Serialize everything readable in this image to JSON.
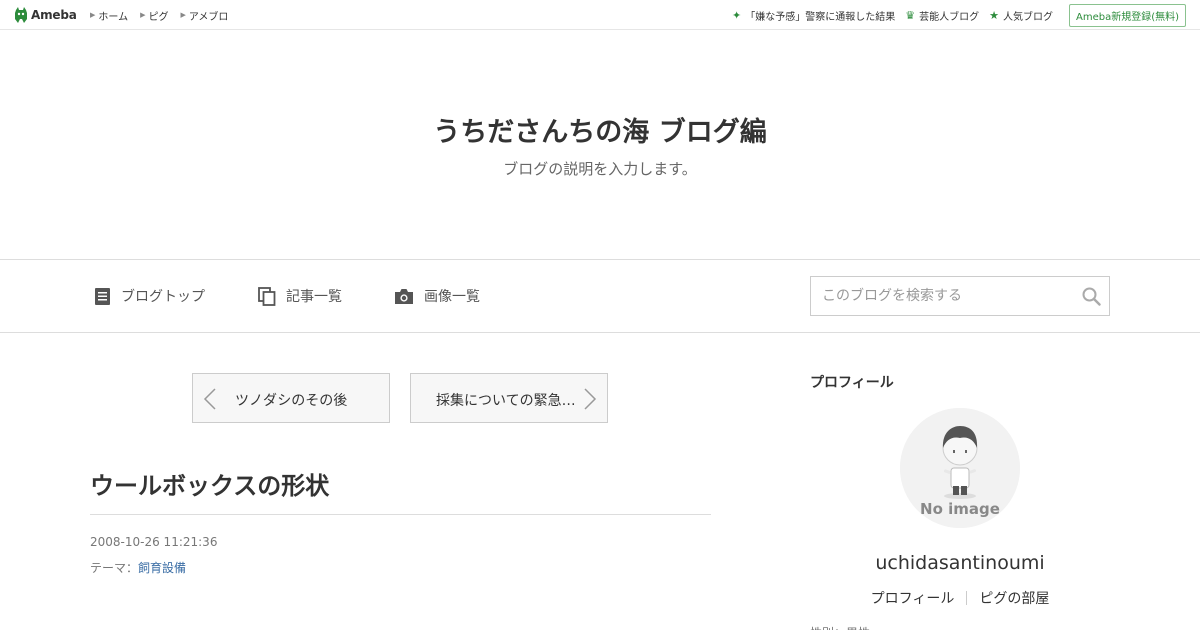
{
  "topbar": {
    "logo_text": "Ameba",
    "nav": [
      "ホーム",
      "ピグ",
      "アメブロ"
    ],
    "right_links": [
      {
        "icon": "sparkle-icon",
        "label": "「嫌な予感」警察に通報した結果"
      },
      {
        "icon": "crown-icon",
        "label": "芸能人ブログ"
      },
      {
        "icon": "star-icon",
        "label": "人気ブログ"
      }
    ],
    "register_label": "Ameba新規登録(無料)",
    "accent": "#2d8c3c"
  },
  "header": {
    "title": "うちださんちの海 ブログ編",
    "description": "ブログの説明を入力します。"
  },
  "nav": {
    "items": [
      {
        "icon": "document-icon",
        "label": "ブログトップ"
      },
      {
        "icon": "copy-icon",
        "label": "記事一覧"
      },
      {
        "icon": "camera-icon",
        "label": "画像一覧"
      }
    ],
    "search_placeholder": "このブログを検索する"
  },
  "article": {
    "prev_label": "ツノダシのその後",
    "next_label": "採集についての緊急…",
    "title": "ウールボックスの形状",
    "date": "2008-10-26 11:21:36",
    "theme_prefix": "テーマ：",
    "theme_link": "飼育設備"
  },
  "sidebar": {
    "heading": "プロフィール",
    "avatar_text": "No image",
    "username": "uchidasantinoumi",
    "links": [
      "プロフィール",
      "ピグの部屋"
    ],
    "cut_text": "性別：男性"
  }
}
